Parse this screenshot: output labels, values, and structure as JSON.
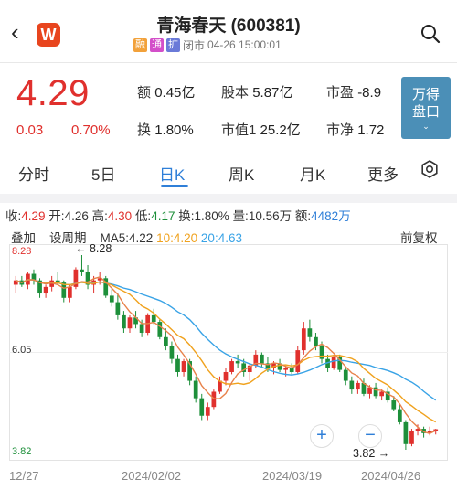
{
  "header": {
    "title": "青海春天 (600381)",
    "tags": [
      "融",
      "通",
      "扩"
    ],
    "status": "闭市",
    "datetime": "04-26 15:00:01",
    "back_glyph": "‹",
    "logo_text": "W"
  },
  "quote": {
    "price": "4.29",
    "change": "0.03",
    "change_pct": "0.70%",
    "fields": [
      {
        "label": "额",
        "value": "0.45亿"
      },
      {
        "label": "股本",
        "value": "5.87亿"
      },
      {
        "label": "市盈",
        "value": "-8.9"
      },
      {
        "label": "换",
        "value": "1.80%"
      },
      {
        "label": "市值1",
        "value": "25.2亿"
      },
      {
        "label": "市净",
        "value": "1.72"
      }
    ],
    "button_line1": "万得",
    "button_line2": "盘口",
    "button_chevron": "⌄"
  },
  "tabs": [
    {
      "label": "分时",
      "active": false
    },
    {
      "label": "5日",
      "active": false
    },
    {
      "label": "日K",
      "active": true
    },
    {
      "label": "周K",
      "active": false
    },
    {
      "label": "月K",
      "active": false
    },
    {
      "label": "更多",
      "active": false
    }
  ],
  "stats": {
    "close_label": "收:",
    "close": "4.29",
    "open_label": "开:",
    "open": "4.26",
    "high_label": "高:",
    "high": "4.30",
    "low_label": "低:",
    "low": "4.17",
    "turnover_label": "换:",
    "turnover": "1.80%",
    "volume_label": "量:",
    "volume": "10.56万",
    "amount_label": "额:",
    "amount": "4482万"
  },
  "controls": {
    "overlay": "叠加",
    "period": "设周期",
    "ma5": "MA5:4.22",
    "ma10_key": "10:",
    "ma10": "4.20",
    "ma20_key": "20:",
    "ma20": "4.63",
    "adjust": "前复权"
  },
  "chart_labels": {
    "y_top": "8.28",
    "y_mid": "6.05",
    "y_bottom": "3.82",
    "max_annotation": "← 8.28",
    "min_annotation": "3.82 →",
    "dates": [
      "12/27",
      "2024/02/02",
      "2024/03/19",
      "2024/04/26"
    ],
    "zoom_in": "+",
    "zoom_out": "−"
  },
  "colors": {
    "up": "#e0302d",
    "down": "#1d8f3a",
    "accent": "#2f7fd8",
    "ma5": "#e8824a",
    "ma10": "#f0a21e",
    "ma20": "#39a3e6"
  },
  "chart_data": {
    "type": "candlestick",
    "ylim": [
      3.82,
      8.28
    ],
    "ohlc": [
      [
        7.6,
        7.8,
        7.4,
        7.7
      ],
      [
        7.7,
        7.8,
        7.55,
        7.6
      ],
      [
        7.6,
        7.9,
        7.5,
        7.85
      ],
      [
        7.85,
        7.95,
        7.6,
        7.7
      ],
      [
        7.7,
        7.75,
        7.3,
        7.4
      ],
      [
        7.4,
        7.6,
        7.3,
        7.55
      ],
      [
        7.55,
        7.8,
        7.45,
        7.7
      ],
      [
        7.7,
        7.9,
        7.6,
        7.65
      ],
      [
        7.65,
        7.7,
        7.2,
        7.3
      ],
      [
        7.3,
        7.6,
        7.2,
        7.55
      ],
      [
        7.55,
        8.0,
        7.5,
        7.95
      ],
      [
        7.95,
        8.28,
        7.8,
        7.9
      ],
      [
        7.9,
        8.05,
        7.5,
        7.6
      ],
      [
        7.6,
        7.8,
        7.4,
        7.7
      ],
      [
        7.7,
        7.9,
        7.6,
        7.75
      ],
      [
        7.75,
        7.8,
        7.3,
        7.35
      ],
      [
        7.35,
        7.5,
        7.1,
        7.2
      ],
      [
        7.2,
        7.4,
        6.8,
        6.9
      ],
      [
        6.9,
        7.0,
        6.5,
        6.6
      ],
      [
        6.6,
        6.9,
        6.5,
        6.85
      ],
      [
        6.85,
        7.0,
        6.6,
        6.7
      ],
      [
        6.7,
        6.8,
        6.4,
        6.5
      ],
      [
        6.5,
        6.95,
        6.45,
        6.9
      ],
      [
        6.9,
        7.05,
        6.7,
        6.75
      ],
      [
        6.75,
        6.8,
        6.35,
        6.4
      ],
      [
        6.4,
        6.6,
        6.1,
        6.2
      ],
      [
        6.2,
        6.3,
        5.8,
        5.9
      ],
      [
        5.9,
        6.0,
        5.5,
        5.6
      ],
      [
        5.6,
        5.9,
        5.5,
        5.85
      ],
      [
        5.85,
        5.9,
        5.3,
        5.4
      ],
      [
        5.4,
        5.5,
        4.9,
        5.0
      ],
      [
        5.0,
        5.1,
        4.5,
        4.6
      ],
      [
        4.6,
        4.9,
        4.5,
        4.8
      ],
      [
        4.8,
        5.2,
        4.75,
        5.15
      ],
      [
        5.15,
        5.5,
        5.1,
        5.4
      ],
      [
        5.4,
        5.7,
        5.3,
        5.6
      ],
      [
        5.6,
        5.9,
        5.55,
        5.85
      ],
      [
        5.85,
        6.0,
        5.7,
        5.8
      ],
      [
        5.8,
        5.9,
        5.5,
        5.6
      ],
      [
        5.6,
        5.8,
        5.4,
        5.75
      ],
      [
        5.75,
        6.1,
        5.7,
        6.0
      ],
      [
        6.0,
        6.05,
        5.7,
        5.8
      ],
      [
        5.8,
        5.95,
        5.6,
        5.7
      ],
      [
        5.7,
        5.85,
        5.55,
        5.8
      ],
      [
        5.8,
        5.9,
        5.6,
        5.65
      ],
      [
        5.65,
        5.75,
        5.5,
        5.7
      ],
      [
        5.7,
        5.8,
        5.55,
        5.6
      ],
      [
        5.6,
        6.2,
        5.55,
        6.1
      ],
      [
        6.1,
        6.75,
        6.0,
        6.6
      ],
      [
        6.6,
        6.8,
        6.3,
        6.4
      ],
      [
        6.4,
        6.5,
        6.1,
        6.2
      ],
      [
        6.2,
        6.3,
        5.8,
        5.9
      ],
      [
        5.9,
        6.0,
        5.6,
        5.7
      ],
      [
        5.7,
        6.0,
        5.65,
        5.95
      ],
      [
        5.95,
        6.0,
        5.6,
        5.65
      ],
      [
        5.65,
        5.7,
        5.3,
        5.4
      ],
      [
        5.4,
        5.5,
        5.1,
        5.2
      ],
      [
        5.2,
        5.4,
        5.1,
        5.35
      ],
      [
        5.35,
        5.45,
        5.05,
        5.1
      ],
      [
        5.1,
        5.3,
        5.0,
        5.25
      ],
      [
        5.25,
        5.35,
        5.0,
        5.05
      ],
      [
        5.05,
        5.2,
        4.95,
        5.15
      ],
      [
        5.15,
        5.25,
        4.9,
        4.95
      ],
      [
        4.95,
        5.05,
        4.7,
        4.75
      ],
      [
        4.75,
        4.85,
        4.4,
        4.45
      ],
      [
        4.45,
        4.5,
        3.82,
        3.95
      ],
      [
        3.95,
        4.3,
        3.9,
        4.25
      ],
      [
        4.25,
        4.4,
        4.15,
        4.3
      ],
      [
        4.3,
        4.35,
        4.1,
        4.2
      ],
      [
        4.2,
        4.35,
        4.15,
        4.26
      ],
      [
        4.26,
        4.3,
        4.17,
        4.29
      ]
    ]
  }
}
